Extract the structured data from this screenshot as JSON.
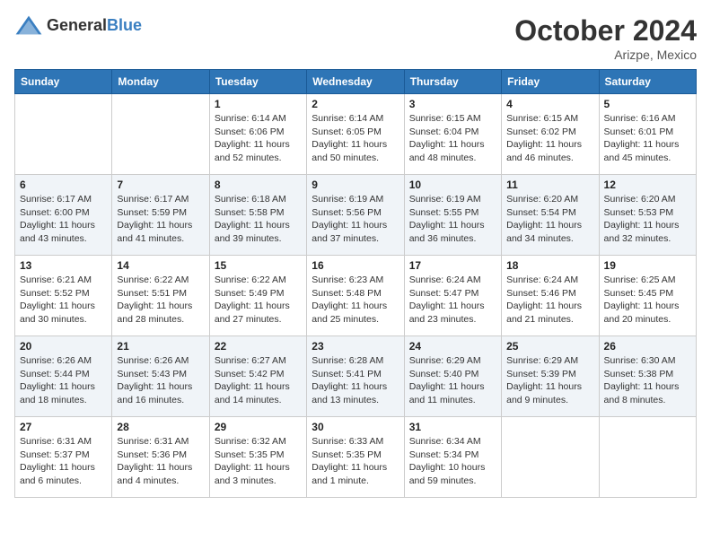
{
  "header": {
    "logo_general": "General",
    "logo_blue": "Blue",
    "month_title": "October 2024",
    "location": "Arizpe, Mexico"
  },
  "weekdays": [
    "Sunday",
    "Monday",
    "Tuesday",
    "Wednesday",
    "Thursday",
    "Friday",
    "Saturday"
  ],
  "weeks": [
    [
      {
        "day": "",
        "info": ""
      },
      {
        "day": "",
        "info": ""
      },
      {
        "day": "1",
        "info": "Sunrise: 6:14 AM\nSunset: 6:06 PM\nDaylight: 11 hours\nand 52 minutes."
      },
      {
        "day": "2",
        "info": "Sunrise: 6:14 AM\nSunset: 6:05 PM\nDaylight: 11 hours\nand 50 minutes."
      },
      {
        "day": "3",
        "info": "Sunrise: 6:15 AM\nSunset: 6:04 PM\nDaylight: 11 hours\nand 48 minutes."
      },
      {
        "day": "4",
        "info": "Sunrise: 6:15 AM\nSunset: 6:02 PM\nDaylight: 11 hours\nand 46 minutes."
      },
      {
        "day": "5",
        "info": "Sunrise: 6:16 AM\nSunset: 6:01 PM\nDaylight: 11 hours\nand 45 minutes."
      }
    ],
    [
      {
        "day": "6",
        "info": "Sunrise: 6:17 AM\nSunset: 6:00 PM\nDaylight: 11 hours\nand 43 minutes."
      },
      {
        "day": "7",
        "info": "Sunrise: 6:17 AM\nSunset: 5:59 PM\nDaylight: 11 hours\nand 41 minutes."
      },
      {
        "day": "8",
        "info": "Sunrise: 6:18 AM\nSunset: 5:58 PM\nDaylight: 11 hours\nand 39 minutes."
      },
      {
        "day": "9",
        "info": "Sunrise: 6:19 AM\nSunset: 5:56 PM\nDaylight: 11 hours\nand 37 minutes."
      },
      {
        "day": "10",
        "info": "Sunrise: 6:19 AM\nSunset: 5:55 PM\nDaylight: 11 hours\nand 36 minutes."
      },
      {
        "day": "11",
        "info": "Sunrise: 6:20 AM\nSunset: 5:54 PM\nDaylight: 11 hours\nand 34 minutes."
      },
      {
        "day": "12",
        "info": "Sunrise: 6:20 AM\nSunset: 5:53 PM\nDaylight: 11 hours\nand 32 minutes."
      }
    ],
    [
      {
        "day": "13",
        "info": "Sunrise: 6:21 AM\nSunset: 5:52 PM\nDaylight: 11 hours\nand 30 minutes."
      },
      {
        "day": "14",
        "info": "Sunrise: 6:22 AM\nSunset: 5:51 PM\nDaylight: 11 hours\nand 28 minutes."
      },
      {
        "day": "15",
        "info": "Sunrise: 6:22 AM\nSunset: 5:49 PM\nDaylight: 11 hours\nand 27 minutes."
      },
      {
        "day": "16",
        "info": "Sunrise: 6:23 AM\nSunset: 5:48 PM\nDaylight: 11 hours\nand 25 minutes."
      },
      {
        "day": "17",
        "info": "Sunrise: 6:24 AM\nSunset: 5:47 PM\nDaylight: 11 hours\nand 23 minutes."
      },
      {
        "day": "18",
        "info": "Sunrise: 6:24 AM\nSunset: 5:46 PM\nDaylight: 11 hours\nand 21 minutes."
      },
      {
        "day": "19",
        "info": "Sunrise: 6:25 AM\nSunset: 5:45 PM\nDaylight: 11 hours\nand 20 minutes."
      }
    ],
    [
      {
        "day": "20",
        "info": "Sunrise: 6:26 AM\nSunset: 5:44 PM\nDaylight: 11 hours\nand 18 minutes."
      },
      {
        "day": "21",
        "info": "Sunrise: 6:26 AM\nSunset: 5:43 PM\nDaylight: 11 hours\nand 16 minutes."
      },
      {
        "day": "22",
        "info": "Sunrise: 6:27 AM\nSunset: 5:42 PM\nDaylight: 11 hours\nand 14 minutes."
      },
      {
        "day": "23",
        "info": "Sunrise: 6:28 AM\nSunset: 5:41 PM\nDaylight: 11 hours\nand 13 minutes."
      },
      {
        "day": "24",
        "info": "Sunrise: 6:29 AM\nSunset: 5:40 PM\nDaylight: 11 hours\nand 11 minutes."
      },
      {
        "day": "25",
        "info": "Sunrise: 6:29 AM\nSunset: 5:39 PM\nDaylight: 11 hours\nand 9 minutes."
      },
      {
        "day": "26",
        "info": "Sunrise: 6:30 AM\nSunset: 5:38 PM\nDaylight: 11 hours\nand 8 minutes."
      }
    ],
    [
      {
        "day": "27",
        "info": "Sunrise: 6:31 AM\nSunset: 5:37 PM\nDaylight: 11 hours\nand 6 minutes."
      },
      {
        "day": "28",
        "info": "Sunrise: 6:31 AM\nSunset: 5:36 PM\nDaylight: 11 hours\nand 4 minutes."
      },
      {
        "day": "29",
        "info": "Sunrise: 6:32 AM\nSunset: 5:35 PM\nDaylight: 11 hours\nand 3 minutes."
      },
      {
        "day": "30",
        "info": "Sunrise: 6:33 AM\nSunset: 5:35 PM\nDaylight: 11 hours\nand 1 minute."
      },
      {
        "day": "31",
        "info": "Sunrise: 6:34 AM\nSunset: 5:34 PM\nDaylight: 10 hours\nand 59 minutes."
      },
      {
        "day": "",
        "info": ""
      },
      {
        "day": "",
        "info": ""
      }
    ]
  ]
}
